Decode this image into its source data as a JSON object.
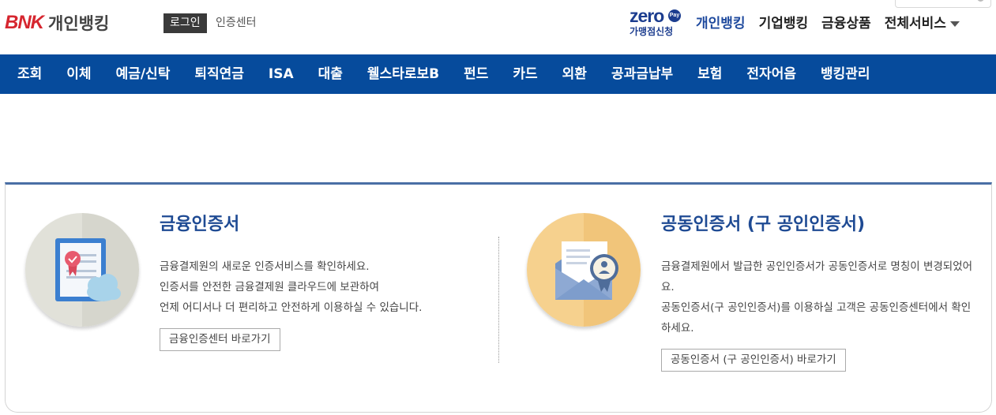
{
  "header": {
    "logo_brand": "BNK",
    "logo_title": "개인뱅킹",
    "login_label": "로그인",
    "cert_center_label": "인증센터",
    "zero_pay": {
      "word": "zero",
      "badge": "Pay",
      "sub": "가맹점신청"
    },
    "top_nav": [
      {
        "label": "개인뱅킹"
      },
      {
        "label": "기업뱅킹"
      },
      {
        "label": "금융상품"
      },
      {
        "label": "전체서비스"
      }
    ]
  },
  "menu": [
    {
      "label": "조회"
    },
    {
      "label": "이체"
    },
    {
      "label": "예금/신탁"
    },
    {
      "label": "퇴직연금"
    },
    {
      "label": "ISA"
    },
    {
      "label": "대출"
    },
    {
      "label": "웰스타로보B"
    },
    {
      "label": "펀드"
    },
    {
      "label": "카드"
    },
    {
      "label": "외환"
    },
    {
      "label": "공과금납부"
    },
    {
      "label": "보험"
    },
    {
      "label": "전자어음"
    },
    {
      "label": "뱅킹관리"
    }
  ],
  "cards": [
    {
      "title": "금융인증서",
      "lines": [
        "금융결제원의 새로운 인증서비스를 확인하세요.",
        "인증서를 안전한 금융결제원 클라우드에 보관하여",
        "언제 어디서나 더 편리하고 안전하게 이용하실 수 있습니다."
      ],
      "button": "금융인증센터 바로가기"
    },
    {
      "title": "공동인증서 (구 공인인증서)",
      "lines": [
        "금융결제원에서 발급한 공인인증서가 공동인증서로 명칭이 변경되었어요.",
        "공동인증서(구 공인인증서)를 이용하실 고객은 공동인증센터에서 확인하세요."
      ],
      "button": "공동인증서 (구 공인인증서) 바로가기"
    }
  ],
  "colors": {
    "menu_bg": "#064b9c",
    "title_blue": "#1e4a93",
    "brand_red": "#d6262f"
  }
}
